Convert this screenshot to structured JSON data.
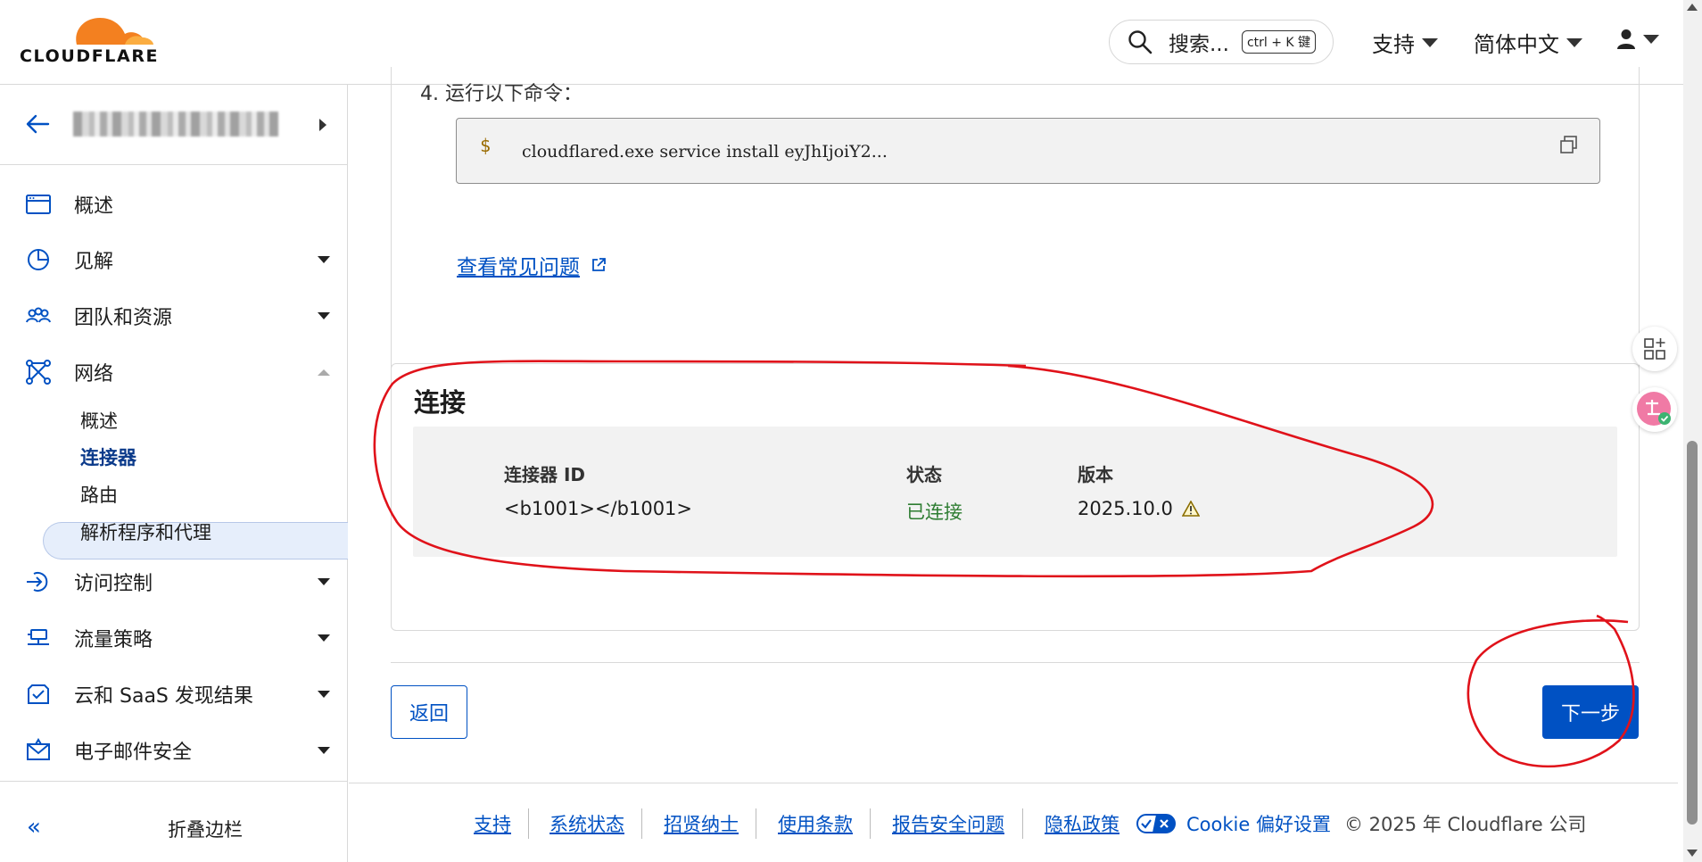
{
  "header": {
    "logo_text": "CLOUDFLARE",
    "search_label": "搜索...",
    "search_shortcut": "ctrl + K 键",
    "support_label": "支持",
    "language_label": "简体中文",
    "brand_color": "#f38020",
    "accent_color": "#0051c3"
  },
  "sidebar": {
    "items": [
      {
        "label": "概述",
        "icon": "browser-window-icon"
      },
      {
        "label": "见解",
        "icon": "pie-chart-icon"
      },
      {
        "label": "团队和资源",
        "icon": "users-icon"
      },
      {
        "label": "网络",
        "icon": "network-icon"
      },
      {
        "label": "访问控制",
        "icon": "access-icon"
      },
      {
        "label": "流量策略",
        "icon": "traffic-icon"
      },
      {
        "label": "云和 SaaS 发现结果",
        "icon": "cloud-check-icon"
      },
      {
        "label": "电子邮件安全",
        "icon": "email-security-icon"
      }
    ],
    "network_subitems": [
      "概述",
      "连接器",
      "路由",
      "解析程序和代理"
    ],
    "active_subitem": "连接器",
    "collapse_label": "折叠边栏"
  },
  "main": {
    "step_text": "4. 运行以下命令：",
    "command_prompt": "$",
    "command": "cloudflared.exe service install eyJhIjoiY2...",
    "faq_link": "查看常见问题",
    "connections": {
      "title": "连接",
      "columns": [
        "连接器 ID",
        "状态",
        "版本"
      ],
      "row": {
        "id": "<b1001></b1001>",
        "status": "已连接",
        "version": "2025.10.0"
      },
      "status_color": "#2e7d32"
    },
    "back_button": "返回",
    "next_button": "下一步"
  },
  "footer": {
    "links": [
      "支持",
      "系统状态",
      "招贤纳士",
      "使用条款",
      "报告安全问题",
      "隐私政策"
    ],
    "cookie": "Cookie 偏好设置",
    "copyright": "© 2025 年 Cloudflare 公司"
  }
}
